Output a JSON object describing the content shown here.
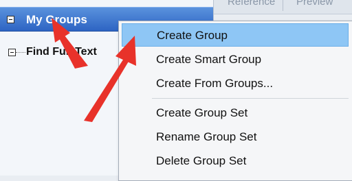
{
  "groups_pane": {
    "header_label": "My Groups",
    "tree_items": [
      {
        "label": "Find Full Text"
      }
    ]
  },
  "tabs": [
    {
      "label": "Reference"
    },
    {
      "label": "Preview"
    }
  ],
  "context_menu": {
    "items": [
      {
        "label": "Create Group",
        "highlighted": true
      },
      {
        "label": "Create Smart Group"
      },
      {
        "label": "Create From Groups..."
      },
      {
        "label": "Create Group Set"
      },
      {
        "label": "Rename Group Set"
      },
      {
        "label": "Delete Group Set"
      }
    ]
  },
  "colors": {
    "header_blue": "#2d64c3",
    "menu_highlight": "#8ec6f5",
    "annotation_arrow": "#e8322a"
  }
}
